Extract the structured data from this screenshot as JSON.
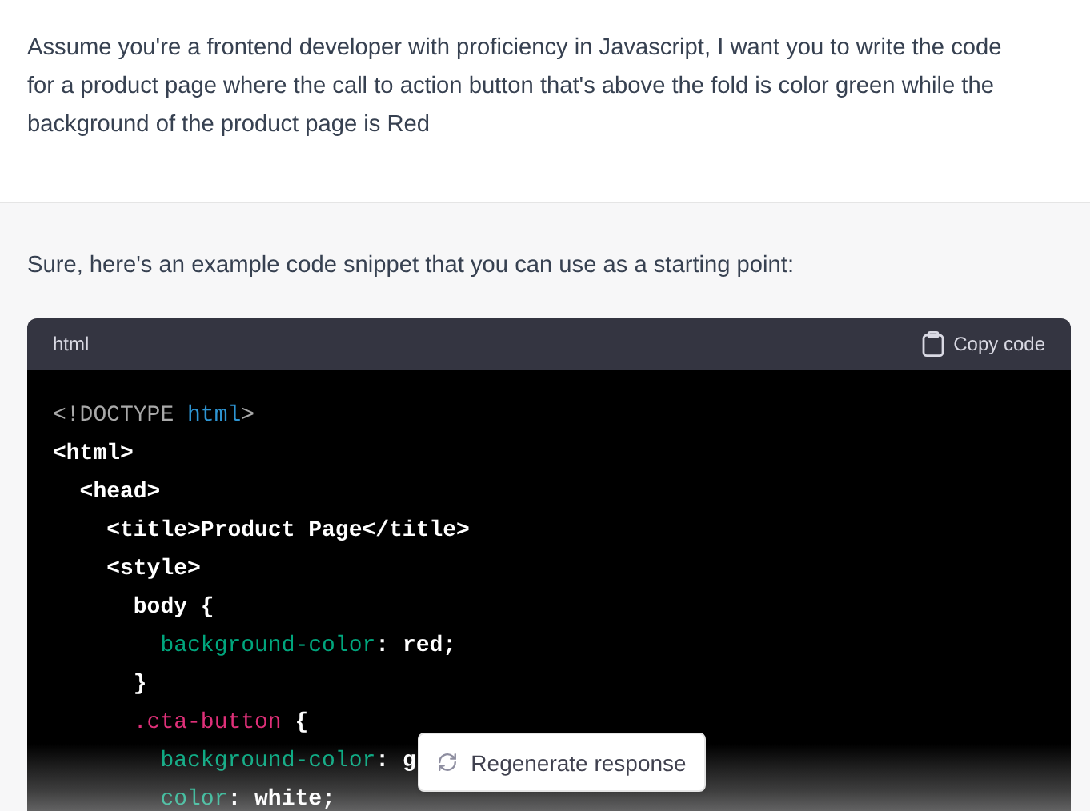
{
  "user_message": {
    "text": "Assume you're a frontend developer with proficiency in Javascript, I want you to write the code for  a product page where the call to action button that's above the fold is color green while the background of the product page is Red"
  },
  "assistant_message": {
    "text": "Sure, here's an example code snippet that you can use as a starting point:"
  },
  "code_block": {
    "language": "html",
    "copy_label": "Copy code",
    "lines": [
      {
        "tokens": [
          {
            "kind": "meta",
            "text": "<!DOCTYPE "
          },
          {
            "kind": "keyword",
            "text": "html"
          },
          {
            "kind": "meta",
            "text": ">"
          }
        ]
      },
      {
        "tokens": [
          {
            "kind": "plain",
            "text": "<html>"
          }
        ]
      },
      {
        "tokens": [
          {
            "kind": "plain",
            "text": "  <head>"
          }
        ]
      },
      {
        "tokens": [
          {
            "kind": "plain",
            "text": "    <title>Product Page</title>"
          }
        ]
      },
      {
        "tokens": [
          {
            "kind": "plain",
            "text": "    <style>"
          }
        ]
      },
      {
        "tokens": [
          {
            "kind": "plain",
            "text": "      body {"
          }
        ]
      },
      {
        "tokens": [
          {
            "kind": "property",
            "text": "        background-color"
          },
          {
            "kind": "plain",
            "text": ": red;"
          }
        ]
      },
      {
        "tokens": [
          {
            "kind": "plain",
            "text": "      }"
          }
        ]
      },
      {
        "tokens": [
          {
            "kind": "selector",
            "text": "      .cta-button"
          },
          {
            "kind": "plain",
            "text": " {"
          }
        ]
      },
      {
        "tokens": [
          {
            "kind": "property",
            "text": "        background-color"
          },
          {
            "kind": "plain",
            "text": ": g"
          }
        ]
      },
      {
        "tokens": [
          {
            "kind": "property",
            "text": "        color"
          },
          {
            "kind": "plain",
            "text": ": white;"
          }
        ]
      }
    ]
  },
  "regenerate_button": {
    "label": "Regenerate response"
  }
}
